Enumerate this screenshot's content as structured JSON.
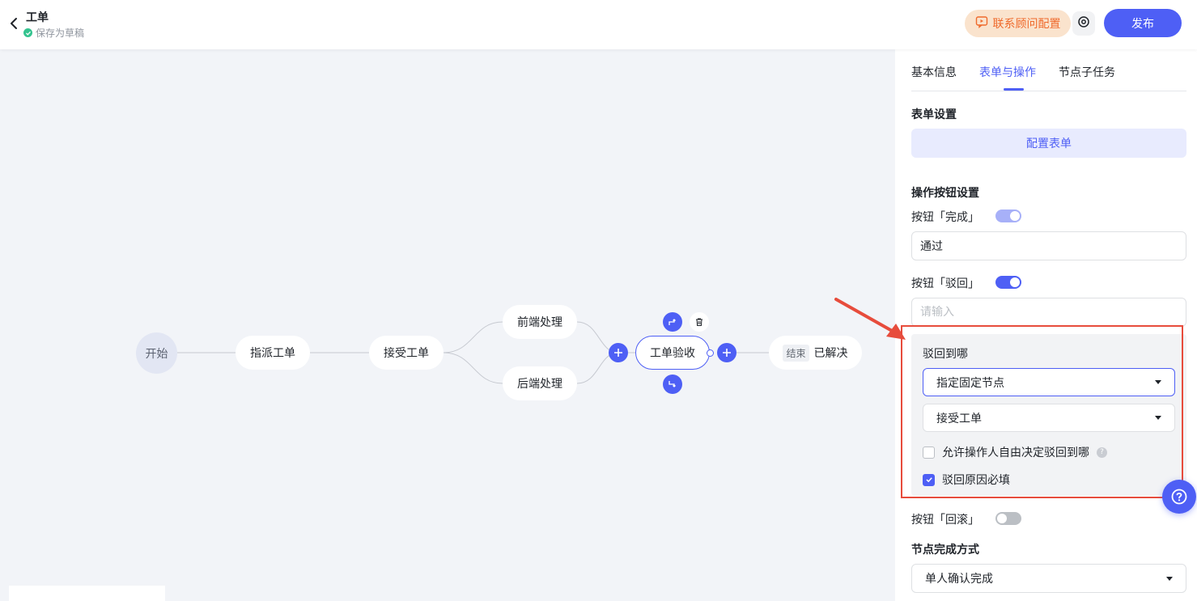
{
  "header": {
    "title": "工单",
    "draft_status": "保存为草稿",
    "contact_button": "联系顾问配置",
    "publish_button": "发布"
  },
  "flow": {
    "nodes": {
      "start": "开始",
      "assign": "指派工单",
      "accept": "接受工单",
      "frontend": "前端处理",
      "backend": "后端处理",
      "verify": "工单验收",
      "end_tag": "结束",
      "end_label": "已解决"
    }
  },
  "panel": {
    "tabs": [
      "基本信息",
      "表单与操作",
      "节点子任务"
    ],
    "active_tab": 1,
    "form_settings_title": "表单设置",
    "config_form_button": "配置表单",
    "action_buttons_title": "操作按钮设置",
    "complete_button": {
      "label": "按钮「完成」",
      "enabled": true,
      "value": "通过"
    },
    "reject_button": {
      "label": "按钮「驳回」",
      "enabled": true,
      "placeholder": "请输入"
    },
    "reject_to": {
      "title": "驳回到哪",
      "mode_value": "指定固定节点",
      "node_value": "接受工单",
      "allow_free_choice": {
        "label": "允许操作人自由决定驳回到哪",
        "checked": false
      },
      "reason_required": {
        "label": "驳回原因必填",
        "checked": true
      }
    },
    "rollback_button": {
      "label": "按钮「回滚」",
      "enabled": false
    },
    "completion_mode_title": "节点完成方式",
    "completion_mode_value": "单人确认完成"
  },
  "colors": {
    "accent": "#4e5ff5",
    "annotation": "#e74c3c",
    "contact_bg": "#fae3cd",
    "contact_text": "#ef6a2c"
  }
}
